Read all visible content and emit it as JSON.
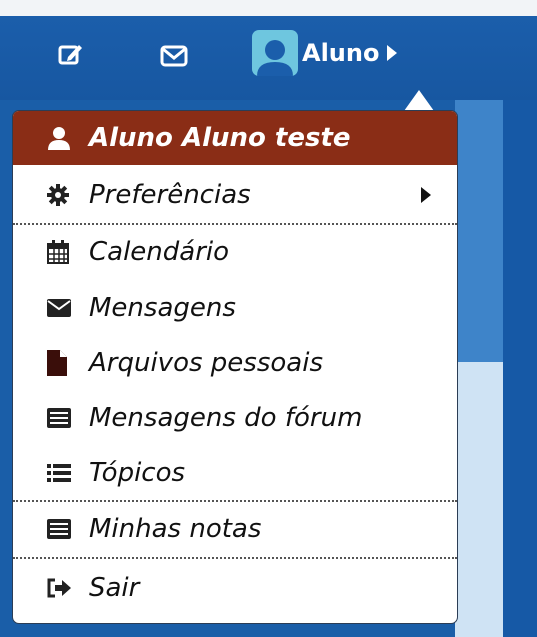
{
  "topbar": {
    "edit_icon": "edit-icon",
    "mail_icon": "envelope-icon",
    "user_label": "Aluno"
  },
  "menu": {
    "items": [
      {
        "label": "Aluno Aluno teste",
        "icon": "user-icon"
      },
      {
        "label": "Preferências",
        "icon": "gear-icon",
        "submenu": true
      },
      {
        "label": "Calendário",
        "icon": "calendar-icon"
      },
      {
        "label": "Mensagens",
        "icon": "envelope-icon"
      },
      {
        "label": "Arquivos pessoais",
        "icon": "file-icon"
      },
      {
        "label": "Mensagens do fórum",
        "icon": "list-box-icon"
      },
      {
        "label": "Tópicos",
        "icon": "list-icon"
      },
      {
        "label": "Minhas notas",
        "icon": "list-box-icon"
      },
      {
        "label": "Sair",
        "icon": "sign-out-icon"
      }
    ]
  },
  "colors": {
    "topbar_blue": "#1b5eab",
    "header_item": "#8a2d16",
    "avatar": "#6ec6df"
  }
}
